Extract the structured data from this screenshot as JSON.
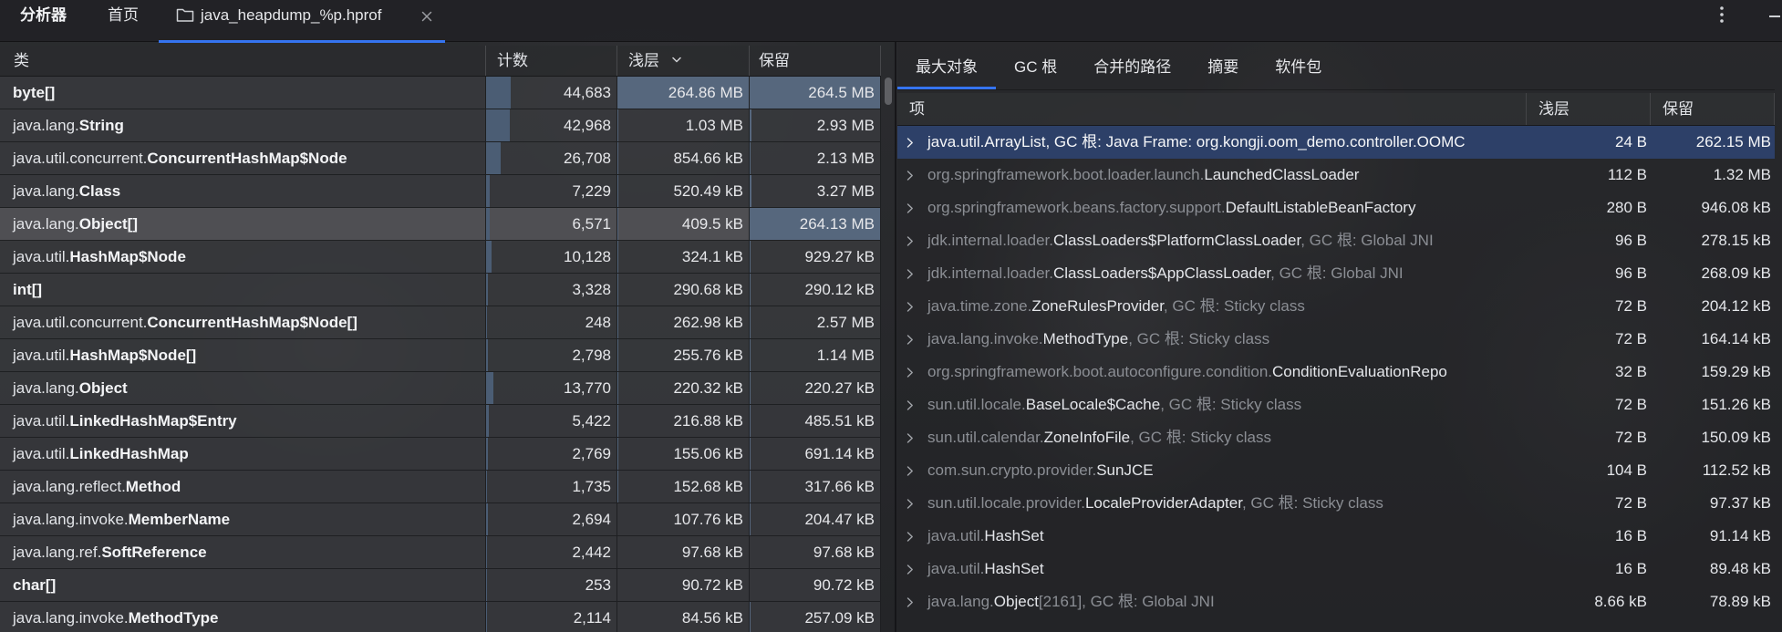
{
  "window": {
    "app_title": "分析器",
    "home_tab": "首页",
    "file_tab": "java_heapdump_%p.hprof"
  },
  "icons": {
    "file_tab": "folder-icon",
    "close_tab": "close-icon",
    "more": "more-vertical-icon",
    "minimize": "minimize-icon",
    "sort": "chevron-down-icon",
    "expand_row": "chevron-right-icon"
  },
  "colors": {
    "accent": "#3574f0",
    "selected_row": "#2d4068",
    "highlighted_row": "rgba(82,83,87,0.92)",
    "size_bar": "#56677d",
    "count_bar": "#4b5d74",
    "dim_text": "#8b8e94",
    "bright_text": "#e4e6ea"
  },
  "left_table": {
    "headers": {
      "class": "类",
      "count": "计数",
      "shallow": "浅层",
      "retained": "保留"
    },
    "highlighted_row": 4,
    "rows": [
      {
        "name": "byte[]",
        "count": "44,683",
        "shallow": "264.86 MB",
        "retained": "264.5 MB"
      },
      {
        "pkg": "java.lang.",
        "name": "String",
        "count": "42,968",
        "shallow": "1.03 MB",
        "retained": "2.93 MB"
      },
      {
        "pkg": "java.util.concurrent.",
        "name": "ConcurrentHashMap$Node",
        "count": "26,708",
        "shallow": "854.66 kB",
        "retained": "2.13 MB"
      },
      {
        "pkg": "java.lang.",
        "name": "Class",
        "count": "7,229",
        "shallow": "520.49 kB",
        "retained": "3.27 MB"
      },
      {
        "pkg": "java.lang.",
        "name": "Object[]",
        "count": "6,571",
        "shallow": "409.5 kB",
        "retained": "264.13 MB"
      },
      {
        "pkg": "java.util.",
        "name": "HashMap$Node",
        "count": "10,128",
        "shallow": "324.1 kB",
        "retained": "929.27 kB"
      },
      {
        "name": "int[]",
        "count": "3,328",
        "shallow": "290.68 kB",
        "retained": "290.12 kB"
      },
      {
        "pkg": "java.util.concurrent.",
        "name": "ConcurrentHashMap$Node[]",
        "count": "248",
        "shallow": "262.98 kB",
        "retained": "2.57 MB"
      },
      {
        "pkg": "java.util.",
        "name": "HashMap$Node[]",
        "count": "2,798",
        "shallow": "255.76 kB",
        "retained": "1.14 MB"
      },
      {
        "pkg": "java.lang.",
        "name": "Object",
        "count": "13,770",
        "shallow": "220.32 kB",
        "retained": "220.27 kB"
      },
      {
        "pkg": "java.util.",
        "name": "LinkedHashMap$Entry",
        "count": "5,422",
        "shallow": "216.88 kB",
        "retained": "485.51 kB"
      },
      {
        "pkg": "java.util.",
        "name": "LinkedHashMap",
        "count": "2,769",
        "shallow": "155.06 kB",
        "retained": "691.14 kB"
      },
      {
        "pkg": "java.lang.reflect.",
        "name": "Method",
        "count": "1,735",
        "shallow": "152.68 kB",
        "retained": "317.66 kB"
      },
      {
        "pkg": "java.lang.invoke.",
        "name": "MemberName",
        "count": "2,694",
        "shallow": "107.76 kB",
        "retained": "204.47 kB"
      },
      {
        "pkg": "java.lang.ref.",
        "name": "SoftReference",
        "count": "2,442",
        "shallow": "97.68 kB",
        "retained": "97.68 kB"
      },
      {
        "name": "char[]",
        "count": "253",
        "shallow": "90.72 kB",
        "retained": "90.72 kB"
      },
      {
        "pkg": "java.lang.invoke.",
        "name": "MethodType",
        "count": "2,114",
        "shallow": "84.56 kB",
        "retained": "257.09 kB"
      }
    ]
  },
  "right_panel": {
    "tabs": [
      "最大对象",
      "GC 根",
      "合并的路径",
      "摘要",
      "软件包"
    ],
    "active_tab": 0,
    "headers": {
      "item": "项",
      "shallow": "浅层",
      "retained": "保留"
    },
    "selected_row": 0,
    "rows": [
      {
        "pkg": "java.util.",
        "name": "ArrayList",
        "suffix": ", GC 根: Java Frame: org.kongji.oom_demo.controller.OOMC",
        "shallow": "24 B",
        "retained": "262.15 MB"
      },
      {
        "pkg": "org.springframework.boot.loader.launch.",
        "name": "LaunchedClassLoader",
        "shallow": "112 B",
        "retained": "1.32 MB"
      },
      {
        "pkg": "org.springframework.beans.factory.support.",
        "name": "DefaultListableBeanFactory",
        "shallow": "280 B",
        "retained": "946.08 kB"
      },
      {
        "pkg": "jdk.internal.loader.",
        "name": "ClassLoaders$PlatformClassLoader",
        "suffix": ", GC 根: Global JNI",
        "shallow": "96 B",
        "retained": "278.15 kB"
      },
      {
        "pkg": "jdk.internal.loader.",
        "name": "ClassLoaders$AppClassLoader",
        "suffix": ", GC 根: Global JNI",
        "shallow": "96 B",
        "retained": "268.09 kB"
      },
      {
        "pkg": "java.time.zone.",
        "name": "ZoneRulesProvider",
        "suffix": ", GC 根: Sticky class",
        "shallow": "72 B",
        "retained": "204.12 kB"
      },
      {
        "pkg": "java.lang.invoke.",
        "name": "MethodType",
        "suffix": ", GC 根: Sticky class",
        "shallow": "72 B",
        "retained": "164.14 kB"
      },
      {
        "pkg": "org.springframework.boot.autoconfigure.condition.",
        "name": "ConditionEvaluationRepo",
        "shallow": "32 B",
        "retained": "159.29 kB"
      },
      {
        "pkg": "sun.util.locale.",
        "name": "BaseLocale$Cache",
        "suffix": ", GC 根: Sticky class",
        "shallow": "72 B",
        "retained": "151.26 kB"
      },
      {
        "pkg": "sun.util.calendar.",
        "name": "ZoneInfoFile",
        "suffix": ", GC 根: Sticky class",
        "shallow": "72 B",
        "retained": "150.09 kB"
      },
      {
        "pkg": "com.sun.crypto.provider.",
        "name": "SunJCE",
        "shallow": "104 B",
        "retained": "112.52 kB"
      },
      {
        "pkg": "sun.util.locale.provider.",
        "name": "LocaleProviderAdapter",
        "suffix": ", GC 根: Sticky class",
        "shallow": "72 B",
        "retained": "97.37 kB"
      },
      {
        "pkg": "java.util.",
        "name": "HashSet",
        "shallow": "16 B",
        "retained": "91.14 kB"
      },
      {
        "pkg": "java.util.",
        "name": "HashSet",
        "shallow": "16 B",
        "retained": "89.48 kB"
      },
      {
        "pkg": "java.lang.",
        "name": "Object",
        "suffix": "[2161], GC 根: Global JNI",
        "shallow": "8.66 kB",
        "retained": "78.89 kB"
      }
    ]
  }
}
